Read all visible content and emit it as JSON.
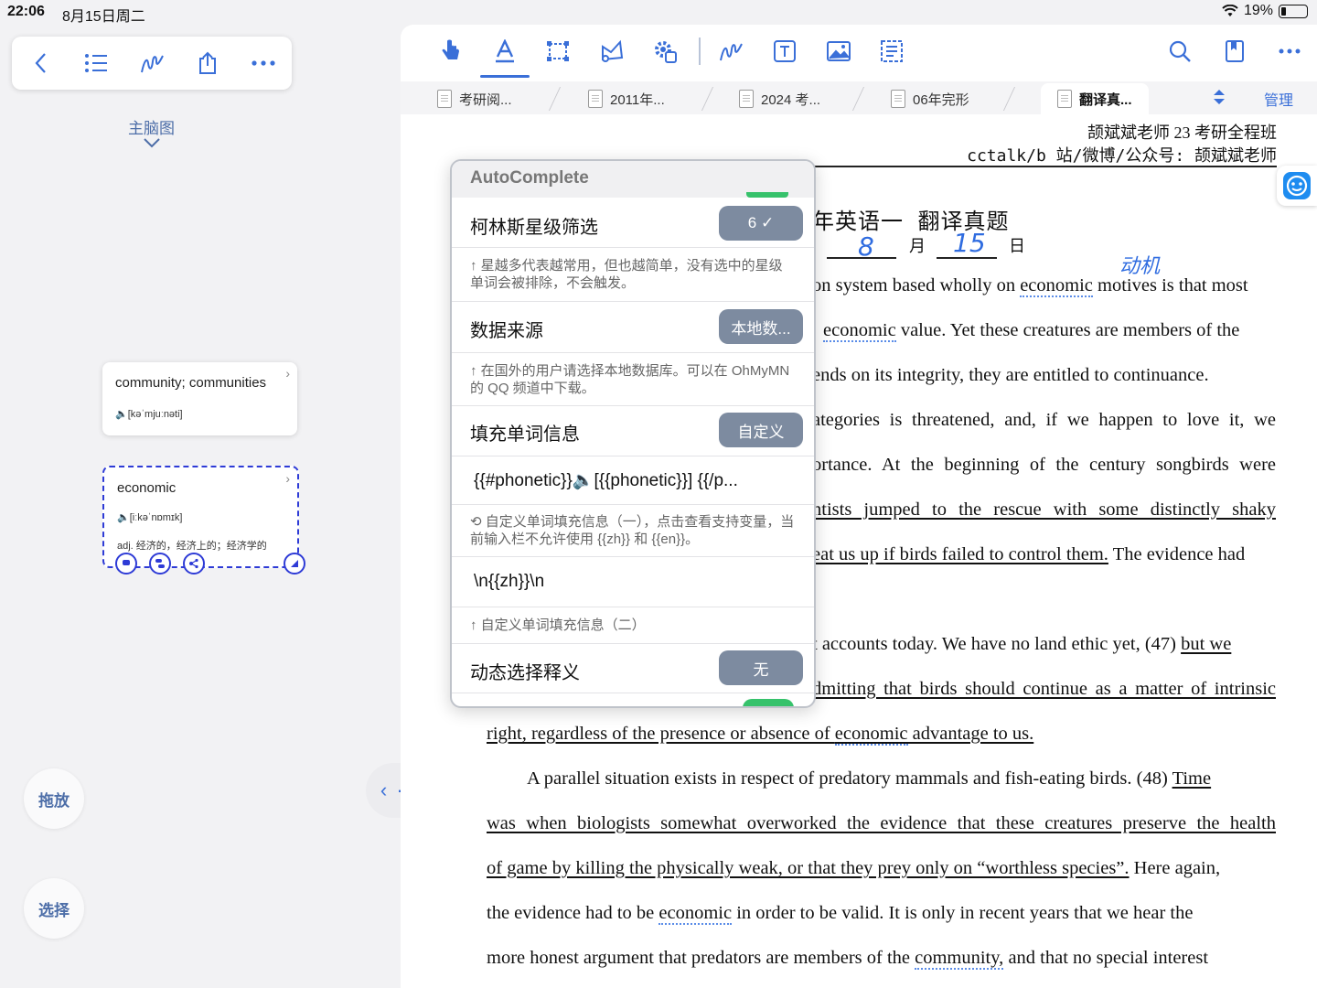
{
  "status_bar": {
    "time": "22:06",
    "date": "8月15日周二",
    "battery": "19%"
  },
  "left_panel": {
    "mindmap_label": "主脑图",
    "cards": [
      {
        "word": "community; communities",
        "phonetic": "🔈[kəˈmjuːnəti]"
      },
      {
        "word": "economic",
        "phonetic": "🔈[iːkəˈnɒmɪk]",
        "definition": "adj. 经济的，经济上的；经济学的"
      }
    ],
    "drag_button": "拖放",
    "select_button": "选择",
    "split_handle": "‹ · ›"
  },
  "tabs": [
    {
      "label": "考研阅..."
    },
    {
      "label": "2011年..."
    },
    {
      "label": "2024 考..."
    },
    {
      "label": "06年完形"
    },
    {
      "label": "翻译真..."
    }
  ],
  "manage_label": "管理",
  "document": {
    "header_line1": "颉斌斌老师 23 考研全程班",
    "header_line2": "cctalk/b 站/微博/公众号: 颉斌斌老师",
    "title": "年英语一 翻译真题",
    "date_month_label": "月",
    "date_day_label": "日",
    "hand_month": "8",
    "hand_day": "15",
    "hand_note": "动机",
    "lines": [
      {
        "a": "on system based wholly on ",
        "b": "economic",
        "c": " motives is that most"
      },
      {
        "a": "",
        "b": "economic",
        "c": " value. Yet these creatures are members of the"
      },
      {
        "a": "ends on its integrity, they are entitled to continuance."
      },
      {
        "a": "ategories is threatened, and, if we happen to love it, we"
      },
      {
        "a": "ortance. At the beginning of the century songbirds were"
      },
      {
        "a": "ntists jumped to the rescue with some distinctly shaky"
      },
      {
        "a": "eat us up if birds failed to control them.",
        "c": " The evidence had"
      },
      {
        "a": "t accounts today. We have no land ethic yet, (47) ",
        "u": "but we"
      },
      {
        "a": "dmitting that birds should continue as a matter of intrinsic"
      },
      {
        "a": "right, regardless of the presence or absence of ",
        "b": "economic",
        "c": " advantage to us."
      },
      {
        "a": "A parallel situation exists in respect of predatory mammals and fish-eating birds. (48) ",
        "u": "Time"
      },
      {
        "a": "was when biologists somewhat overworked the evidence that these creatures preserve the health"
      },
      {
        "a": "of game by killing the physically weak, or that they prey only on “worthless species”.",
        "c": " Here again,"
      },
      {
        "a": "the evidence had to be ",
        "b": "economic",
        "c": " in order to be valid. It is only in recent years that we hear the"
      },
      {
        "a": "more honest argument that predators are members of the ",
        "b": "community,",
        "c": " and that no special interest"
      }
    ]
  },
  "popup": {
    "title": "AutoComplete",
    "rows": [
      {
        "label": "柯林斯星级筛选",
        "value": "6 ✓"
      },
      {
        "hint": "↑ 星越多代表越常用，但也越简单，没有选中的星级单词会被排除，不会触发。"
      },
      {
        "label": "数据来源",
        "value": "本地数..."
      },
      {
        "hint": "↑ 在国外的用户请选择本地数据库。可以在 OhMyMN 的 QQ 频道中下载。"
      },
      {
        "label": "填充单词信息",
        "value": "自定义"
      },
      {
        "input": "{{#phonetic}}🔈[{{phonetic}}] {{/p..."
      },
      {
        "hint": "⟲ 自定义单词填充信息（一），点击查看支持变量，当前输入栏不允许使用 {{zh}} 和 {{en}}。"
      },
      {
        "input": "\\n{{zh}}\\n"
      },
      {
        "hint": "↑ 自定义单词填充信息（二）"
      },
      {
        "label": "动态选择释义",
        "value": "无"
      }
    ]
  },
  "colors": {
    "accent": "#3a6fd8",
    "toggle": "#36c26b",
    "pill": "#7d8ba0",
    "handwriting": "#2f6ce0"
  }
}
